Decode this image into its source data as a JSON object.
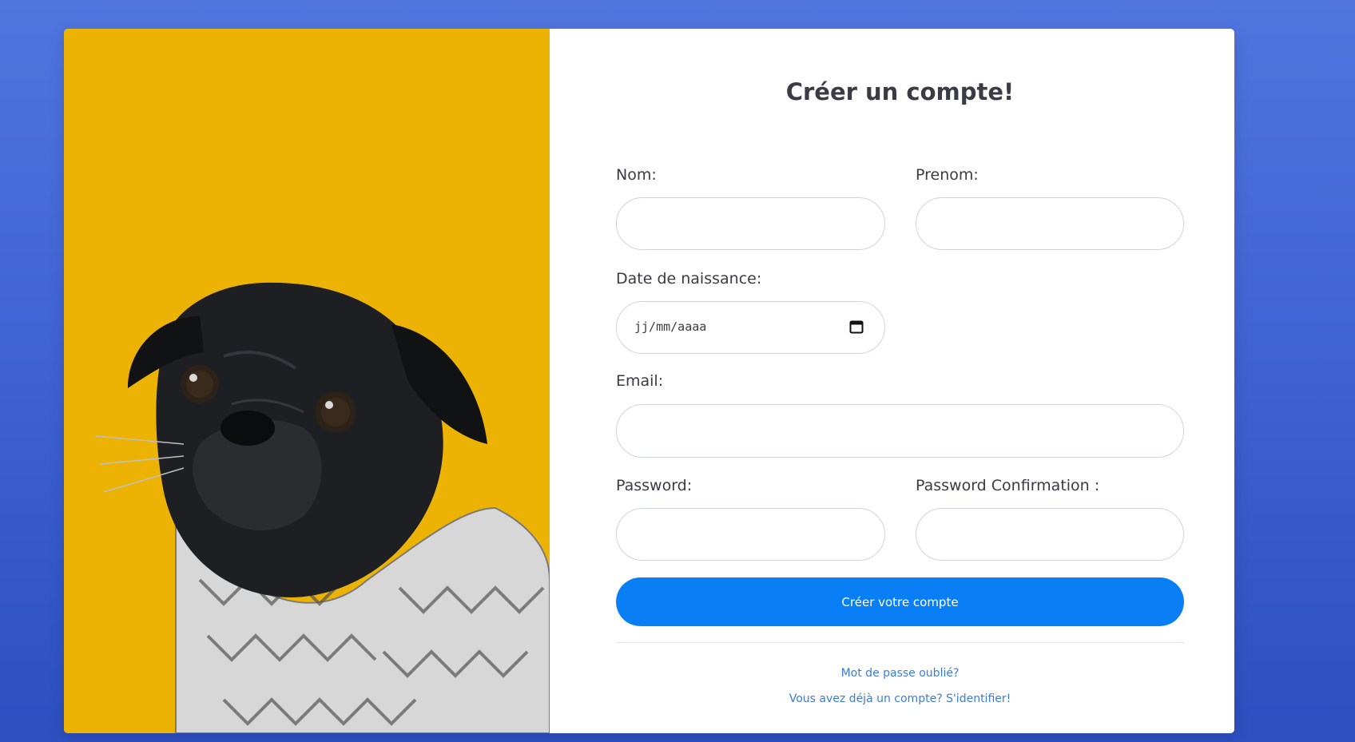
{
  "form": {
    "title": "Créer un compte!",
    "nom_label": "Nom:",
    "prenom_label": "Prenom:",
    "birthdate_label": "Date de naissance:",
    "birthdate_placeholder": "jj/mm/aaaa",
    "email_label": "Email:",
    "password_label": "Password:",
    "password_confirm_label": "Password Confirmation :",
    "submit_label": "Créer votre compte",
    "forgot_password_link": "Mot de passe oublié?",
    "login_link": "Vous avez déjà un compte? S'identifier!"
  },
  "colors": {
    "background": "#4468d8",
    "photo_background": "#ecb204",
    "button": "#0a7ef5",
    "link": "#3b7be0"
  },
  "icons": {
    "date_field": "calendar-icon"
  }
}
